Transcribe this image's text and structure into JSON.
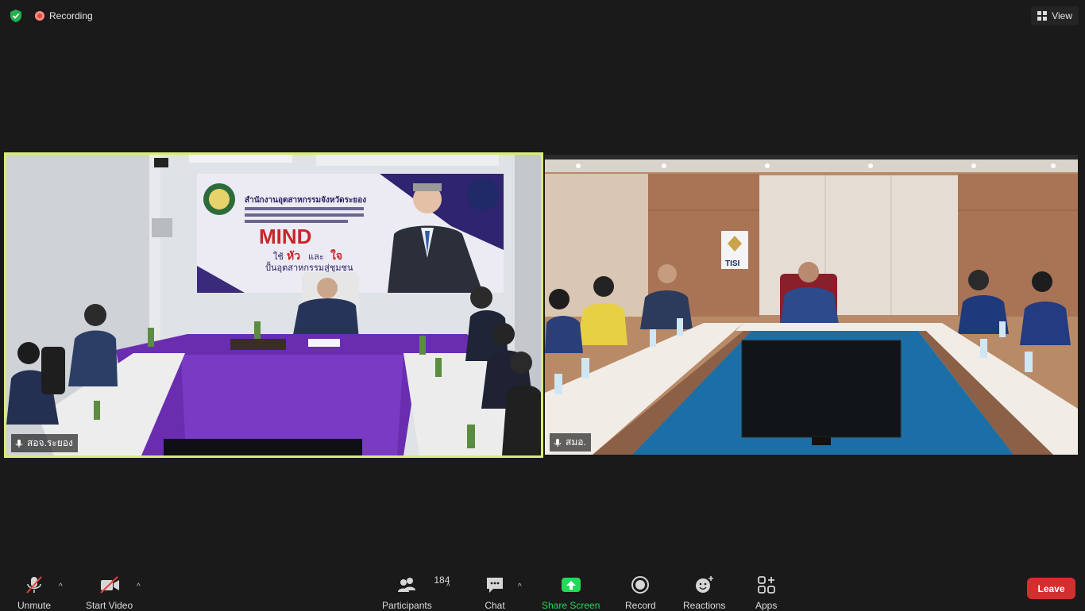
{
  "topbar": {
    "recording_label": "Recording",
    "view_label": "View"
  },
  "tiles": [
    {
      "name": "สอจ.ระยอง"
    },
    {
      "name": "สมอ."
    }
  ],
  "banner": {
    "heading": "สำนักงานอุตสาหกรรมจังหวัดระยอง",
    "mind": "MIND",
    "sub1": "ใช้",
    "hua": "หัว",
    "lae": "และ",
    "jai": "ใจ",
    "sub2": "ปั้นอุตสาหกรรมสู่ชุมชน"
  },
  "tisi_logo_text": "TISI",
  "toolbar": {
    "unmute": "Unmute",
    "start_video": "Start Video",
    "participants": "Participants",
    "participants_count": "184",
    "chat": "Chat",
    "share_screen": "Share Screen",
    "record": "Record",
    "reactions": "Reactions",
    "apps": "Apps",
    "leave": "Leave"
  },
  "colors": {
    "active_speaker_border": "#d9ec75",
    "share_green": "#23d959",
    "leave_red": "#d32f2f",
    "mute_slash": "#e5403a"
  }
}
